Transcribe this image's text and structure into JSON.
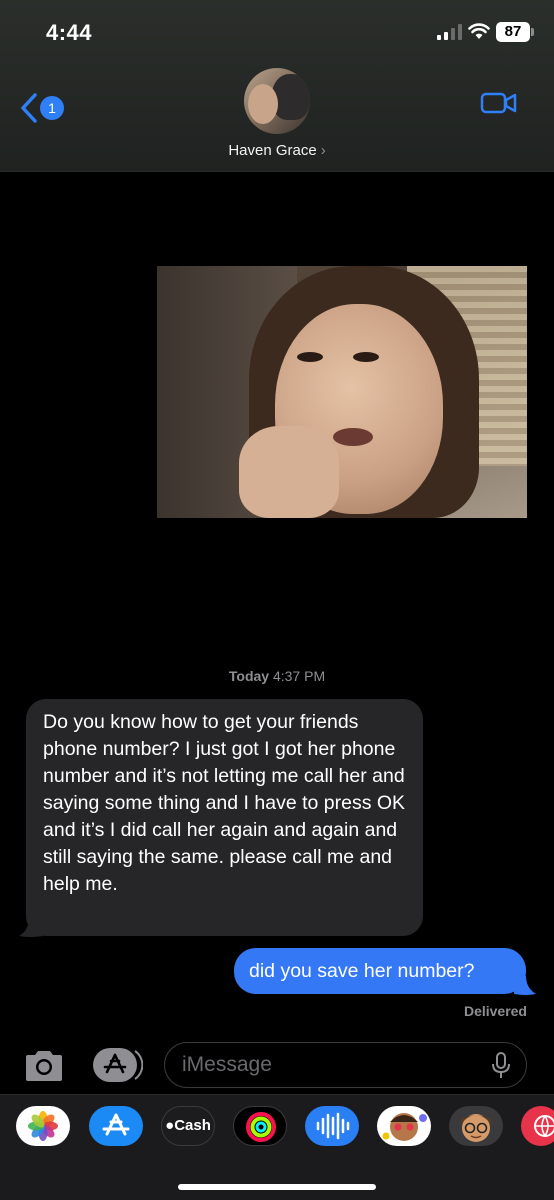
{
  "status_bar": {
    "time": "4:44",
    "battery": "87",
    "icons": [
      "cellular-signal-icon",
      "wifi-icon",
      "battery-icon"
    ]
  },
  "header": {
    "back_badge": "1",
    "contact_name": "Haven Grace",
    "icons": [
      "back-chevron-icon",
      "video-camera-icon"
    ]
  },
  "messages": {
    "timestamp_day": "Today",
    "timestamp_time": "4:37 PM",
    "incoming": "Do you know how to get your friends phone number? I just got I got her phone number and it’s not letting me call her and saying some thing and I have to press OK and it’s I did call her again and again and still saying the same. please call me and help me.",
    "outgoing": "did you save her number?",
    "status": "Delivered"
  },
  "compose": {
    "placeholder": "iMessage",
    "icons": [
      "camera-icon",
      "app-store-icon",
      "microphone-icon"
    ]
  },
  "app_drawer": {
    "cash_label": "Cash",
    "apps": [
      "photos-icon",
      "app-store-icon",
      "apple-cash-icon",
      "fitness-icon",
      "audio-message-icon",
      "memoji-stickers-icon",
      "memoji-icon",
      "web-icon"
    ]
  },
  "colors": {
    "outgoing_bubble": "#3478f6",
    "incoming_bubble": "#262628",
    "accent": "#2f7ff6"
  }
}
